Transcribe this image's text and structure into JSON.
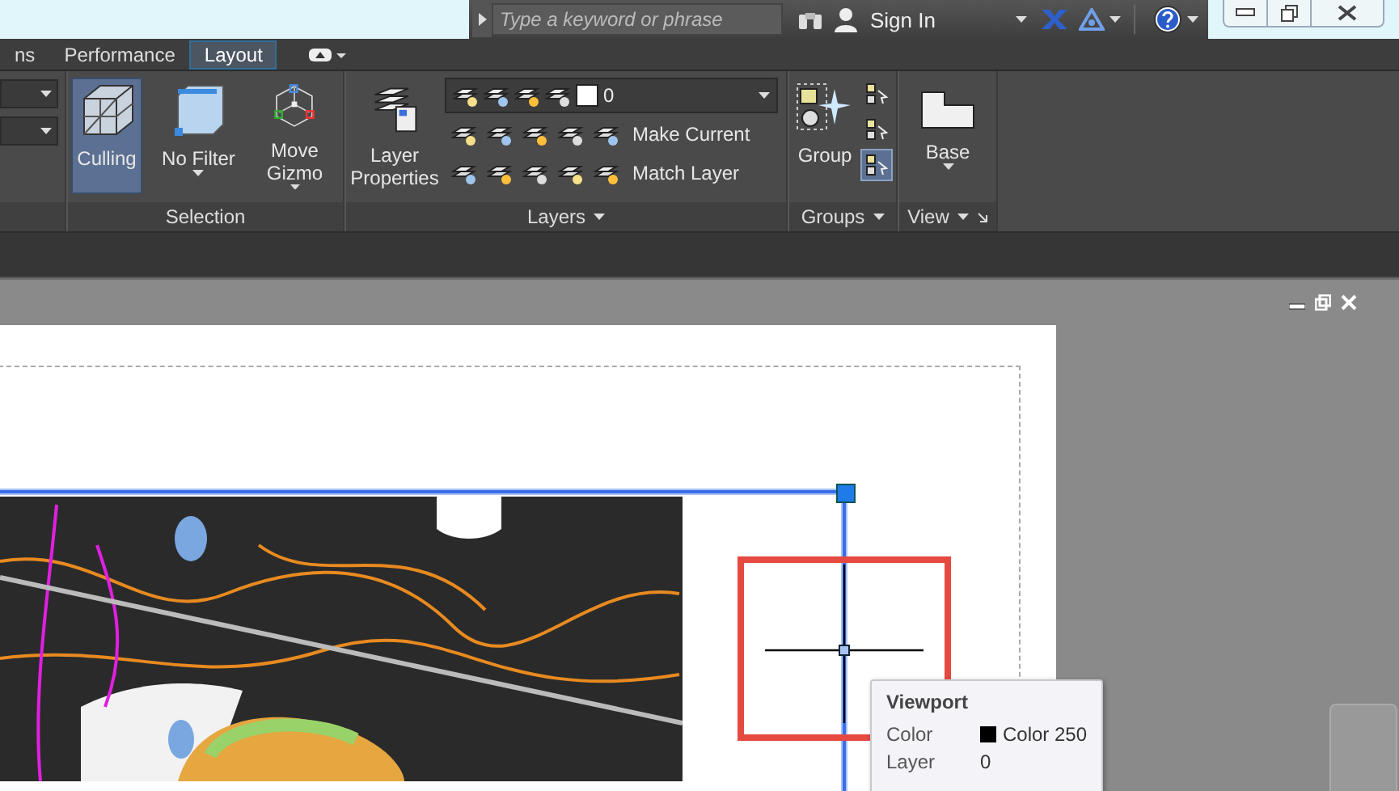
{
  "title_bar": {
    "search": {
      "placeholder": "Type a keyword or phrase"
    },
    "sign_in": "Sign In"
  },
  "tabs": [
    {
      "label": "ns",
      "selected": false
    },
    {
      "label": "Performance",
      "selected": false
    },
    {
      "label": "Layout",
      "selected": true
    }
  ],
  "selection_panel": {
    "title": "Selection",
    "buttons": [
      {
        "label": "Culling",
        "selected": true,
        "dropdown": false
      },
      {
        "label": "No Filter",
        "selected": false,
        "dropdown": true
      },
      {
        "label": "Move Gizmo",
        "selected": false,
        "dropdown": true
      }
    ]
  },
  "layers_panel": {
    "title": "Layers",
    "button": "Layer Properties",
    "current_layer": "0",
    "actions": [
      "Make Current",
      "Match Layer"
    ]
  },
  "groups_panel": {
    "title": "Groups",
    "button": "Group",
    "tools": [
      {
        "selected": false
      },
      {
        "selected": false
      },
      {
        "selected": true
      }
    ]
  },
  "view_panel": {
    "title": "View",
    "button": "Base"
  },
  "tooltip": {
    "title": "Viewport",
    "rows": [
      {
        "label": "Color",
        "value": "Color 250"
      },
      {
        "label": "Layer",
        "value": "0"
      }
    ]
  }
}
